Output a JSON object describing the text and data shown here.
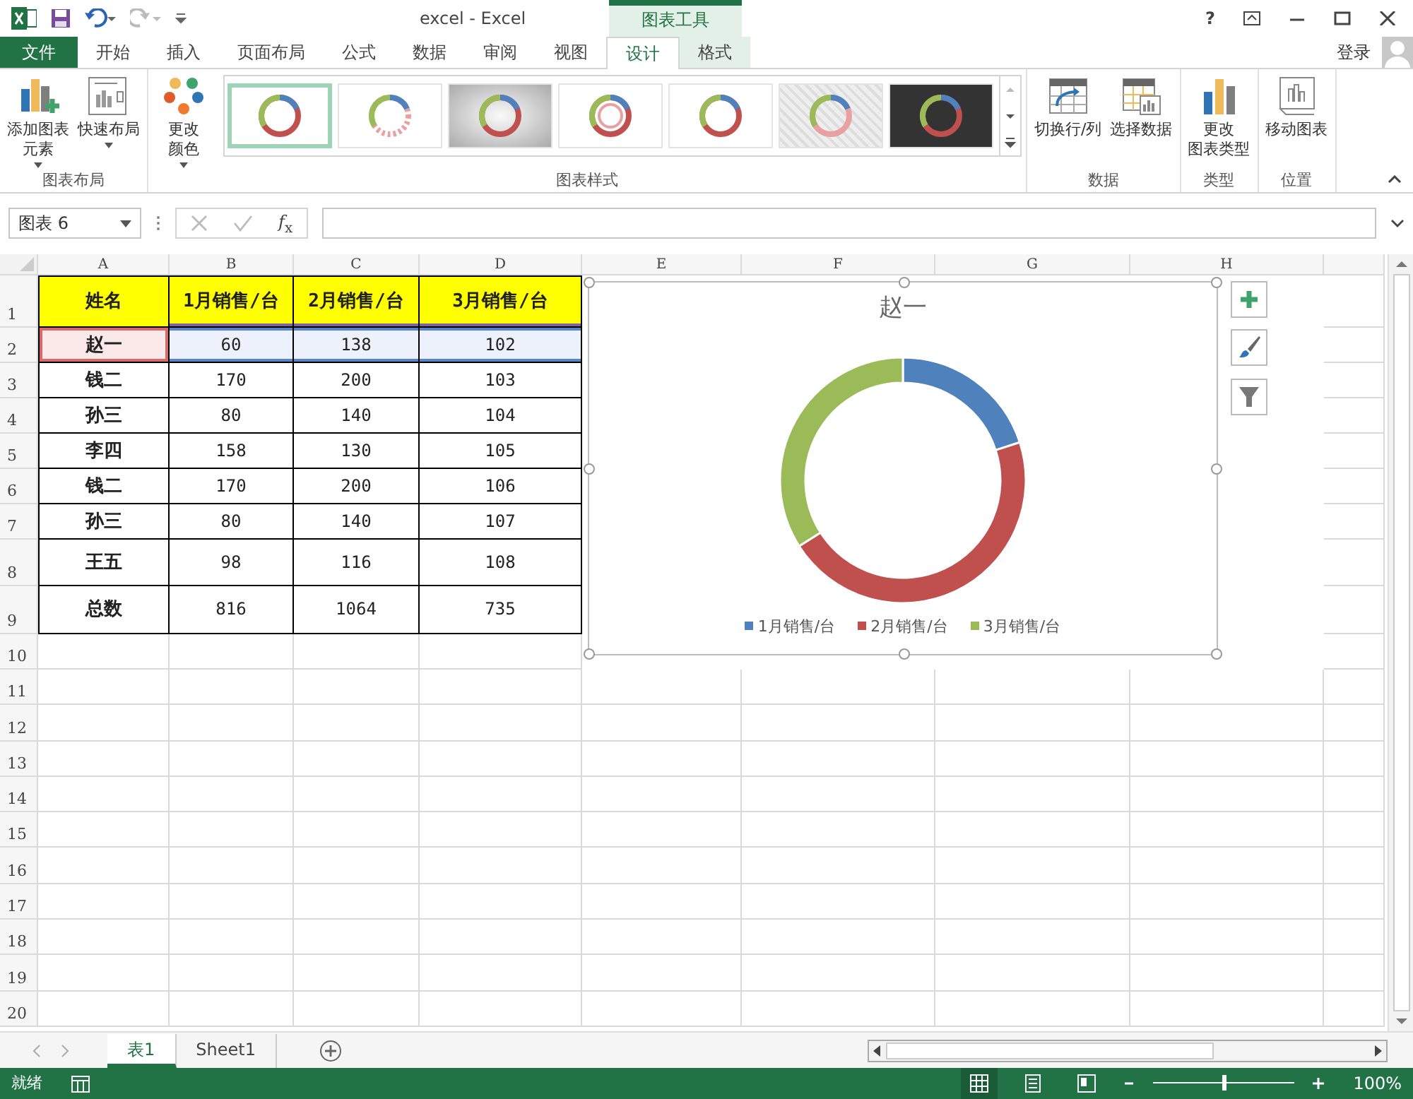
{
  "title_bar": {
    "title": "excel - Excel",
    "context_label": "图表工具",
    "help": "?"
  },
  "tabs": [
    {
      "label": "文件",
      "kind": "file",
      "selected": false,
      "contextual": false
    },
    {
      "label": "开始",
      "kind": "normal",
      "selected": false,
      "contextual": false
    },
    {
      "label": "插入",
      "kind": "normal",
      "selected": false,
      "contextual": false
    },
    {
      "label": "页面布局",
      "kind": "normal",
      "selected": false,
      "contextual": false
    },
    {
      "label": "公式",
      "kind": "normal",
      "selected": false,
      "contextual": false
    },
    {
      "label": "数据",
      "kind": "normal",
      "selected": false,
      "contextual": false
    },
    {
      "label": "审阅",
      "kind": "normal",
      "selected": false,
      "contextual": false
    },
    {
      "label": "视图",
      "kind": "normal",
      "selected": false,
      "contextual": false
    },
    {
      "label": "设计",
      "kind": "normal",
      "selected": true,
      "contextual": true
    },
    {
      "label": "格式",
      "kind": "normal",
      "selected": false,
      "contextual": true
    }
  ],
  "account": {
    "label": "登录"
  },
  "ribbon": {
    "groups": [
      {
        "label": "图表布局",
        "buttons": [
          {
            "lines": [
              "添加图表",
              "元素"
            ],
            "kind": "add-element",
            "dropdown": true
          },
          {
            "lines": [
              "快速布局"
            ],
            "kind": "quick-layout",
            "dropdown": true
          }
        ]
      },
      {
        "label": "图表样式",
        "buttons": [
          {
            "lines": [
              "更改",
              "颜色"
            ],
            "kind": "colors",
            "dropdown": true
          }
        ],
        "gallery": [
          {
            "kind": "plain",
            "selected": true
          },
          {
            "kind": "striped",
            "selected": false
          },
          {
            "kind": "shaded",
            "selected": false
          },
          {
            "kind": "double",
            "selected": false
          },
          {
            "kind": "plain",
            "selected": false
          },
          {
            "kind": "hatched",
            "selected": false
          },
          {
            "kind": "dark",
            "selected": false
          }
        ]
      },
      {
        "label": "数据",
        "buttons": [
          {
            "lines": [
              "切换行/列"
            ],
            "kind": "switch",
            "dropdown": false
          },
          {
            "lines": [
              "选择数据"
            ],
            "kind": "select-data",
            "dropdown": false
          }
        ]
      },
      {
        "label": "类型",
        "buttons": [
          {
            "lines": [
              "更改",
              "图表类型"
            ],
            "kind": "chart-type",
            "dropdown": false
          }
        ]
      },
      {
        "label": "位置",
        "buttons": [
          {
            "lines": [
              "移动图表"
            ],
            "kind": "move-chart",
            "dropdown": false
          }
        ]
      }
    ]
  },
  "formula_bar": {
    "name_box": "图表 6",
    "function_label": "*f*$_{x}$"
  },
  "sheet": {
    "columns": [
      "A",
      "B",
      "C",
      "D",
      "E",
      "F",
      "G",
      "H"
    ],
    "row_numbers": [
      "1",
      "2",
      "3",
      "4",
      "5",
      "6",
      "7",
      "8",
      "9",
      "10",
      "11",
      "12",
      "13",
      "14",
      "15",
      "16",
      "17",
      "18",
      "19",
      "20"
    ],
    "header": {
      "cells": [
        "姓名",
        "1月销售/台",
        "2月销售/台",
        "3月销售/台"
      ],
      "highlighted": true
    },
    "rows": [
      {
        "cells": [
          "赵一",
          "60",
          "138",
          "102"
        ],
        "highlighted": true
      },
      {
        "cells": [
          "钱二",
          "170",
          "200",
          "103"
        ],
        "highlighted": false
      },
      {
        "cells": [
          "孙三",
          "80",
          "140",
          "104"
        ],
        "highlighted": false
      },
      {
        "cells": [
          "李四",
          "158",
          "130",
          "105"
        ],
        "highlighted": false
      },
      {
        "cells": [
          "钱二",
          "170",
          "200",
          "106"
        ],
        "highlighted": false
      },
      {
        "cells": [
          "孙三",
          "80",
          "140",
          "107"
        ],
        "highlighted": false
      },
      {
        "cells": [
          "王五",
          "98",
          "116",
          "108"
        ],
        "highlighted": false
      },
      {
        "cells": [
          "总数",
          "816",
          "1064",
          "735"
        ],
        "highlighted": false
      }
    ]
  },
  "chart": {
    "chart_data": {
      "type": "donut",
      "title": "赵一",
      "categories": [
        "1月销售/台",
        "2月销售/台",
        "3月销售/台"
      ],
      "series": [
        {
          "values": [
            20,
            46,
            34
          ]
        }
      ],
      "legend": "bottom"
    },
    "slices": [
      {
        "color": "#4f81bd"
      },
      {
        "color": "#c0504d"
      },
      {
        "color": "#9bbb59"
      }
    ]
  },
  "sheet_tabs": [
    {
      "label": "表1",
      "selected": true
    },
    {
      "label": "Sheet1",
      "selected": false
    }
  ],
  "status_bar": {
    "status": "就绪",
    "views": [
      {
        "kind": "normal",
        "selected": true
      },
      {
        "kind": "layout",
        "selected": false
      },
      {
        "kind": "pagebreak",
        "selected": false
      }
    ],
    "zoom": {
      "level": 0.5,
      "reading": "100%"
    }
  }
}
